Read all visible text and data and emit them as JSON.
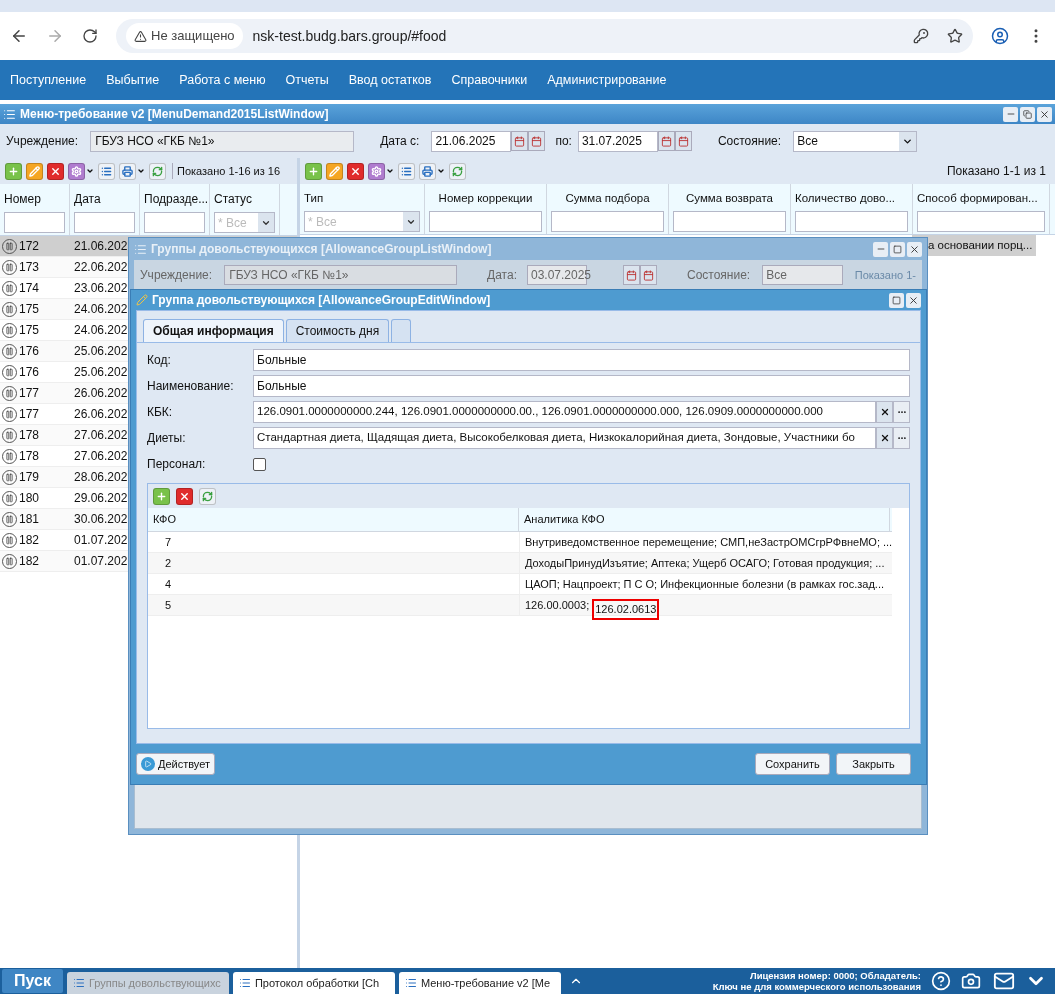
{
  "browser": {
    "security_label": "Не защищено",
    "url": "nsk-test.budg.bars.group/#food"
  },
  "menu": [
    "Поступление",
    "Выбытие",
    "Работа с меню",
    "Отчеты",
    "Ввод остатков",
    "Справочники",
    "Администрирование"
  ],
  "main_window": {
    "title": "Меню-требование v2 [MenuDemand2015ListWindow]",
    "filter": {
      "institution_label": "Учреждение:",
      "institution": "ГБУЗ НСО «ГКБ №1»",
      "date_from_label": "Дата с:",
      "date_from": "21.06.2025",
      "date_to_label": "по:",
      "date_to": "31.07.2025",
      "state_label": "Состояние:",
      "state": "Все"
    },
    "left": {
      "showing": "Показано 1-16 из 16",
      "columns": [
        "Номер",
        "Дата",
        "Подразде...",
        "Статус"
      ],
      "status_filter_placeholder": "* Все",
      "rows": [
        {
          "number": "172",
          "date": "21.06.202",
          "selected": true
        },
        {
          "number": "173",
          "date": "22.06.202",
          "selected": false
        },
        {
          "number": "174",
          "date": "23.06.202",
          "selected": false
        },
        {
          "number": "175",
          "date": "24.06.202",
          "selected": false
        },
        {
          "number": "175",
          "date": "24.06.202",
          "selected": false
        },
        {
          "number": "176",
          "date": "25.06.202",
          "selected": false
        },
        {
          "number": "176",
          "date": "25.06.202",
          "selected": false
        },
        {
          "number": "177",
          "date": "26.06.202",
          "selected": false
        },
        {
          "number": "177",
          "date": "26.06.202",
          "selected": false
        },
        {
          "number": "178",
          "date": "27.06.202",
          "selected": false
        },
        {
          "number": "178",
          "date": "27.06.202",
          "selected": false
        },
        {
          "number": "179",
          "date": "28.06.202",
          "selected": false
        },
        {
          "number": "180",
          "date": "29.06.202",
          "selected": false
        },
        {
          "number": "181",
          "date": "30.06.202",
          "selected": false
        },
        {
          "number": "182",
          "date": "01.07.202",
          "selected": false
        },
        {
          "number": "182",
          "date": "01.07.202",
          "selected": false
        }
      ]
    },
    "right": {
      "showing": "Показано 1-1 из 1",
      "columns": [
        "Тип",
        "Номер коррекции",
        "Сумма подбора",
        "Сумма возврата",
        "Количество дово...",
        "Способ формирован..."
      ],
      "type_filter_placeholder": "* Все",
      "rows": [
        {
          "column_6": "а основании порц...",
          "selected": true
        }
      ]
    }
  },
  "list_window": {
    "title": "Группы довольствующихся [AllowanceGroupListWindow]",
    "institution_label": "Учреждение:",
    "institution": "ГБУЗ НСО «ГКБ №1»",
    "date_label": "Дата:",
    "date": "03.07.2025",
    "state_label": "Состояние:",
    "state": "Все",
    "showing": "Показано 1-"
  },
  "edit_window": {
    "title": "Группа довольствующихся [AllowanceGroupEditWindow]",
    "tabs": [
      {
        "label": "Общая информация",
        "selected": true
      },
      {
        "label": "Стоимость дня",
        "selected": false
      }
    ],
    "fields": [
      {
        "label": "Код:",
        "value": "Больные",
        "kind": "text"
      },
      {
        "label": "Наименование:",
        "value": "Больные",
        "kind": "text"
      },
      {
        "label": "КБК:",
        "value": "126.0901.0000000000.244, 126.0901.0000000000.00., 126.0901.0000000000.000, 126.0909.0000000000.000",
        "kind": "picker"
      },
      {
        "label": "Диеты:",
        "value": "Стандартная диета, Щадящая диета, Высокобелковая диета, Низкокалорийная диета, Зондовые, Участники бо",
        "kind": "picker"
      },
      {
        "label": "Персонал:",
        "checked": false,
        "kind": "checkbox"
      }
    ],
    "kfo_table": {
      "columns": [
        "КФО",
        "Аналитика КФО"
      ],
      "rows": [
        {
          "kfo": "7",
          "analytics": "Внутриведомственное перемещение; СМП,неЗастрОМСгрРФвнеМО; ..."
        },
        {
          "kfo": "2",
          "analytics": "ДоходыПринудИзъятие; Аптека; Ущерб ОСАГО; Готовая продукция; ..."
        },
        {
          "kfo": "4",
          "analytics": "ЦАОП; Нацпроект; П С О; Инфекционные болезни (в рамках гос.зад..."
        },
        {
          "kfo": "5",
          "analytics": "126.00.0003;",
          "marked": "126.02.0613"
        }
      ]
    },
    "status_button": "Действует",
    "buttons": [
      "Сохранить",
      "Закрыть"
    ]
  },
  "taskbar": {
    "start": "Пуск",
    "windows": [
      {
        "label": "Группы довольствующихс",
        "active": true
      },
      {
        "label": "Протокол обработки [Ch",
        "active": false
      },
      {
        "label": "Меню-требование v2 [Me",
        "active": false
      }
    ],
    "license": [
      "Лицензия номер: 0000; Обладатель:",
      "Ключ не для коммерческого использования"
    ]
  }
}
